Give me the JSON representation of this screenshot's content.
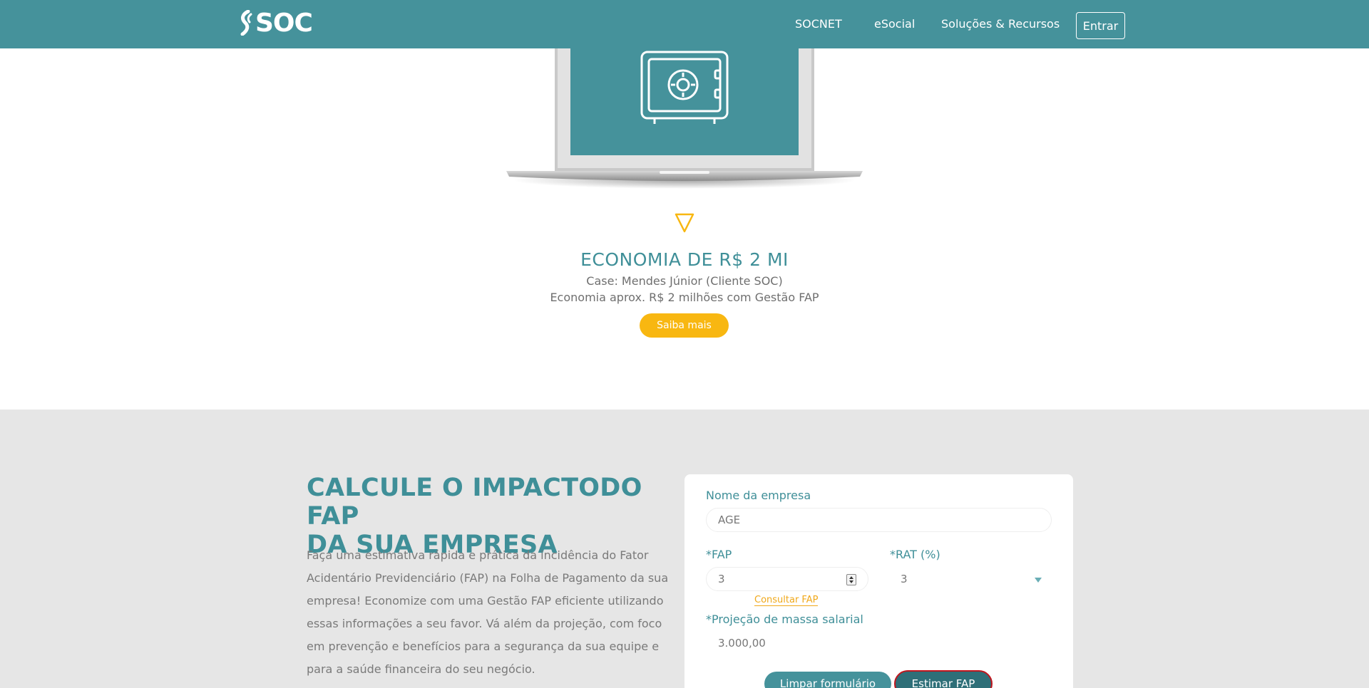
{
  "header": {
    "logo_text": "SOC",
    "nav": [
      {
        "label": "SOCNET"
      },
      {
        "label": "eSocial"
      },
      {
        "label": "Soluções & Recursos"
      }
    ],
    "login_label": "Entrar"
  },
  "hero": {
    "icon": "safe-icon",
    "title": "ECONOMIA DE R$ 2 MI",
    "line1": "Case: Mendes Júnior (Cliente SOC)",
    "line2": "Economia aprox. R$ 2 milhões com Gestão FAP",
    "button_label": "Saiba mais"
  },
  "calculator": {
    "title_line1": "CALCULE O IMPACTODO FAP",
    "title_line2": "DA SUA EMPRESA",
    "description": "Faça uma estimativa rápida e prática da incidência do Fator Acidentário Previdenciário (FAP) na Folha de Pagamento da sua empresa! Economize com uma Gestão FAP eficiente utilizando essas informações a seu favor. Vá além da projeção, com foco em prevenção e benefícios para a segurança da sua equipe e para a saúde financeira do seu negócio.",
    "form": {
      "company_label": "Nome da empresa",
      "company_value": "AGE",
      "fap_label": "*FAP",
      "fap_value": "3",
      "fap_link": "Consultar FAP",
      "rat_label": "*RAT (%)",
      "rat_value": "3",
      "payroll_label": "*Projeção de massa salarial",
      "payroll_value": "3.000,00",
      "clear_label": "Limpar formulário",
      "estimate_label": "Estimar FAP"
    }
  },
  "colors": {
    "primary": "#45929b",
    "accent": "#f8b711",
    "section_bg": "#e6e6e6",
    "focus_border": "#c0161e"
  }
}
